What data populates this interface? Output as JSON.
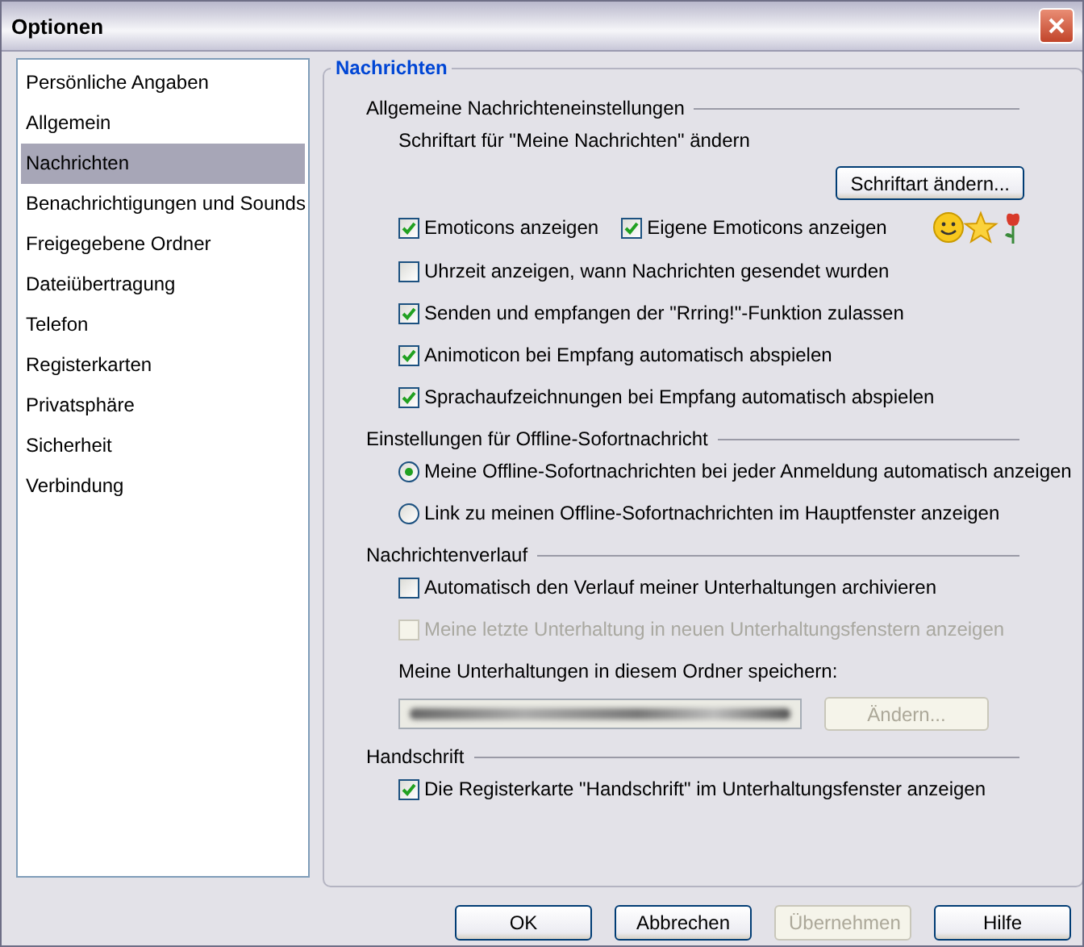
{
  "window": {
    "title": "Optionen"
  },
  "sidebar": {
    "items": [
      {
        "label": "Persönliche Angaben",
        "selected": false
      },
      {
        "label": "Allgemein",
        "selected": false
      },
      {
        "label": "Nachrichten",
        "selected": true
      },
      {
        "label": "Benachrichtigungen und Sounds",
        "selected": false
      },
      {
        "label": "Freigegebene Ordner",
        "selected": false
      },
      {
        "label": "Dateiübertragung",
        "selected": false
      },
      {
        "label": "Telefon",
        "selected": false
      },
      {
        "label": "Registerkarten",
        "selected": false
      },
      {
        "label": "Privatsphäre",
        "selected": false
      },
      {
        "label": "Sicherheit",
        "selected": false
      },
      {
        "label": "Verbindung",
        "selected": false
      }
    ]
  },
  "panel": {
    "title": "Nachrichten",
    "groups": [
      {
        "title": "Allgemeine Nachrichteneinstellungen",
        "items": [
          {
            "kind": "label",
            "text": "Schriftart für \"Meine Nachrichten\" ändern"
          },
          {
            "kind": "button",
            "label": "Schriftart ändern...",
            "disabled": false
          },
          {
            "kind": "checkbox_pair",
            "options": [
              {
                "label": "Emoticons anzeigen",
                "checked": true,
                "disabled": false
              },
              {
                "label": "Eigene Emoticons anzeigen",
                "checked": true,
                "disabled": false
              }
            ]
          },
          {
            "kind": "checkbox",
            "label": "Uhrzeit anzeigen, wann Nachrichten gesendet wurden",
            "checked": false,
            "disabled": false
          },
          {
            "kind": "checkbox",
            "label": "Senden und empfangen der \"Rrring!\"-Funktion zulassen",
            "checked": true,
            "disabled": false
          },
          {
            "kind": "checkbox",
            "label": "Animoticon bei Empfang automatisch abspielen",
            "checked": true,
            "disabled": false
          },
          {
            "kind": "checkbox",
            "label": "Sprachaufzeichnungen bei Empfang automatisch abspielen",
            "checked": true,
            "disabled": false
          }
        ]
      },
      {
        "title": "Einstellungen für Offline-Sofortnachricht",
        "items": [
          {
            "kind": "radio",
            "label": "Meine Offline-Sofortnachrichten bei jeder Anmeldung automatisch anzeigen",
            "selected": true
          },
          {
            "kind": "radio",
            "label": "Link zu meinen Offline-Sofortnachrichten im Hauptfenster anzeigen",
            "selected": false
          }
        ]
      },
      {
        "title": "Nachrichtenverlauf",
        "items": [
          {
            "kind": "checkbox",
            "label": "Automatisch den Verlauf meiner Unterhaltungen archivieren",
            "checked": false,
            "disabled": false
          },
          {
            "kind": "checkbox",
            "label": "Meine letzte Unterhaltung in neuen Unterhaltungsfenstern anzeigen",
            "checked": false,
            "disabled": true
          },
          {
            "kind": "label",
            "text": "Meine Unterhaltungen in diesem Ordner speichern:"
          },
          {
            "kind": "folder",
            "button": {
              "label": "Ändern...",
              "disabled": true
            }
          }
        ]
      },
      {
        "title": "Handschrift",
        "items": [
          {
            "kind": "checkbox",
            "label": "Die Registerkarte \"Handschrift\" im Unterhaltungsfenster anzeigen",
            "checked": true,
            "disabled": false
          }
        ]
      }
    ]
  },
  "buttons": [
    {
      "label": "OK",
      "disabled": false
    },
    {
      "label": "Abbrechen",
      "disabled": false
    },
    {
      "label": "Übernehmen",
      "disabled": true
    },
    {
      "label": "Hilfe",
      "disabled": false
    }
  ]
}
